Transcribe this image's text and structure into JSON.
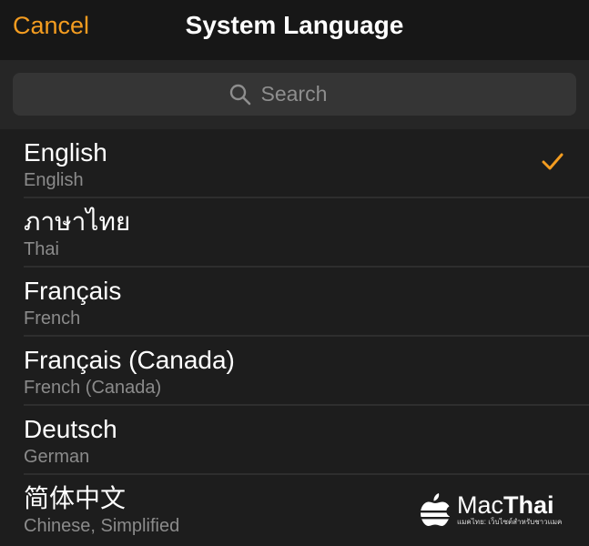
{
  "nav": {
    "cancel_label": "Cancel",
    "title": "System Language"
  },
  "search": {
    "placeholder": "Search",
    "value": ""
  },
  "languages": [
    {
      "name": "English",
      "subtitle": "English",
      "selected": true
    },
    {
      "name": "ภาษาไทย",
      "subtitle": "Thai",
      "selected": false
    },
    {
      "name": "Français",
      "subtitle": "French",
      "selected": false
    },
    {
      "name": "Français (Canada)",
      "subtitle": "French (Canada)",
      "selected": false
    },
    {
      "name": "Deutsch",
      "subtitle": "German",
      "selected": false
    },
    {
      "name": "简体中文",
      "subtitle": "Chinese, Simplified",
      "selected": false
    }
  ],
  "watermark": {
    "brand_regular": "Mac",
    "brand_bold": "Thai",
    "tagline": "แมคไทย: เว็บไซต์สำหรับชาวแมค",
    "logo_icon": "apple-logo-icon"
  },
  "colors": {
    "accent": "#f39c20",
    "background": "#1d1d1d",
    "navbar": "#171717",
    "search_field": "#353535"
  }
}
